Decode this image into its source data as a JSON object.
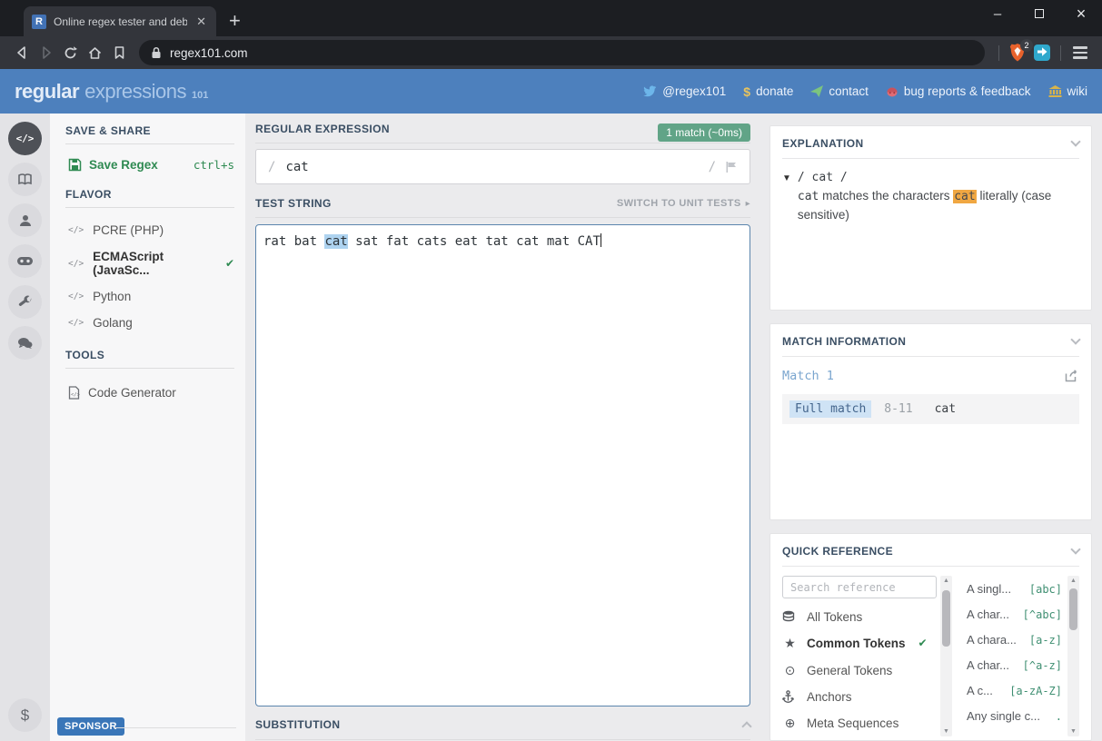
{
  "browser": {
    "tab": {
      "favicon_letter": "R",
      "title": "Online regex tester and debugger:"
    },
    "url": "regex101.com",
    "shield_badge": "2"
  },
  "site_header": {
    "logo": {
      "part1": "regular",
      "part2": "expressions",
      "part3": "101"
    },
    "links": [
      {
        "icon": "twitter-icon",
        "label": "@regex101"
      },
      {
        "icon": "donate-icon",
        "label": "donate"
      },
      {
        "icon": "contact-icon",
        "label": "contact"
      },
      {
        "icon": "bug-icon",
        "label": "bug reports & feedback"
      },
      {
        "icon": "wiki-icon",
        "label": "wiki"
      }
    ]
  },
  "sidebar": {
    "save_share": {
      "title": "SAVE & SHARE",
      "save_label": "Save Regex",
      "shortcut": "ctrl+s"
    },
    "flavor": {
      "title": "FLAVOR",
      "items": [
        {
          "label": "PCRE (PHP)",
          "selected": false
        },
        {
          "label": "ECMAScript (JavaSc...",
          "selected": true
        },
        {
          "label": "Python",
          "selected": false
        },
        {
          "label": "Golang",
          "selected": false
        }
      ]
    },
    "tools": {
      "title": "TOOLS",
      "items": [
        {
          "label": "Code Generator"
        }
      ]
    },
    "sponsor_label": "SPONSOR"
  },
  "main": {
    "regex": {
      "title": "REGULAR EXPRESSION",
      "match_badge": "1 match (~0ms)",
      "open_delim": "/",
      "pattern": "cat",
      "close_delim": "/"
    },
    "test_string": {
      "title": "TEST STRING",
      "switch_label": "SWITCH TO UNIT TESTS",
      "before": "rat bat ",
      "match": "cat",
      "after": " sat fat cats eat tat cat mat CAT"
    },
    "substitution": {
      "title": "SUBSTITUTION"
    }
  },
  "explanation": {
    "title": "EXPLANATION",
    "regex_line": "/ cat /",
    "token": "cat",
    "text_before": " matches the characters ",
    "highlight": "cat",
    "text_after": " literally (case sensitive)"
  },
  "match_info": {
    "title": "MATCH INFORMATION",
    "match_label": "Match 1",
    "row": {
      "badge": "Full match",
      "range": "8-11",
      "value": "cat"
    }
  },
  "quick_reference": {
    "title": "QUICK REFERENCE",
    "search_placeholder": "Search reference",
    "tokens": [
      {
        "icon": "database-icon",
        "label": "All Tokens",
        "selected": false
      },
      {
        "icon": "star-icon",
        "label": "Common Tokens",
        "selected": true
      },
      {
        "icon": "target-icon",
        "label": "General Tokens",
        "selected": false
      },
      {
        "icon": "anchor-icon",
        "label": "Anchors",
        "selected": false
      },
      {
        "icon": "lifebuoy-icon",
        "label": "Meta Sequences",
        "selected": false
      }
    ],
    "items": [
      {
        "label": "A singl...",
        "code": "[abc]"
      },
      {
        "label": "A char...",
        "code": "[^abc]"
      },
      {
        "label": "A chara...",
        "code": "[a-z]"
      },
      {
        "label": "A char...",
        "code": "[^a-z]"
      },
      {
        "label": "A c...",
        "code": "[a-zA-Z]"
      },
      {
        "label": "Any single c...",
        "code": "."
      }
    ]
  },
  "colors": {
    "header_blue": "#4d80bd",
    "accent_green": "#2f8a52",
    "match_badge_green": "#61a487",
    "test_highlight_blue": "#aed3f0",
    "explanation_highlight_orange": "#f0a742",
    "sponsor_blue": "#3a76b8"
  }
}
